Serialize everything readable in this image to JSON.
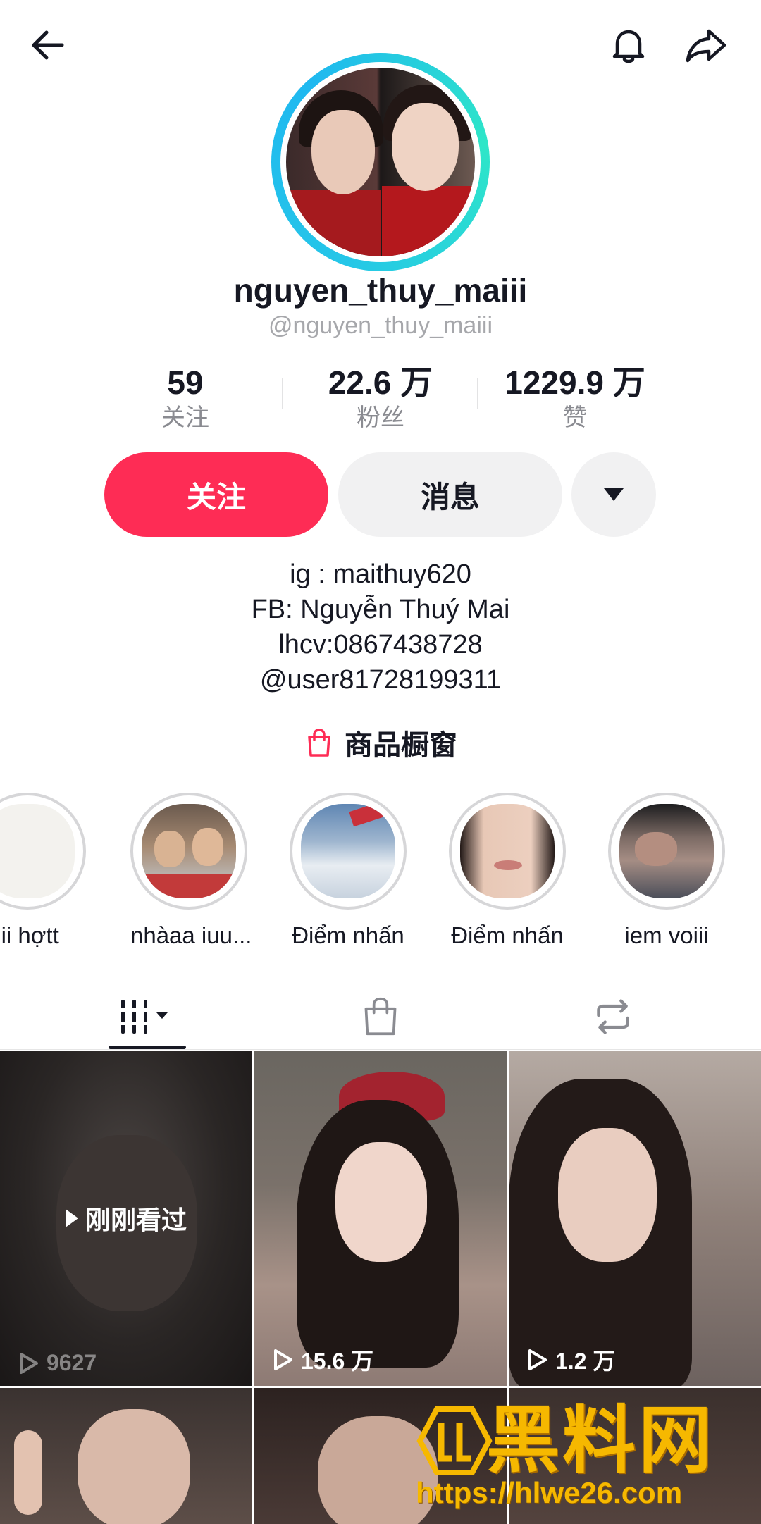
{
  "header": {
    "back_icon": "arrow-left-icon",
    "bell_icon": "bell-icon",
    "share_icon": "share-icon"
  },
  "profile": {
    "display_name": "nguyen_thuy_maiii",
    "handle": "@nguyen_thuy_maiii",
    "ring_color": "#25c6e8"
  },
  "stats": [
    {
      "value": "59",
      "label": "关注"
    },
    {
      "value": "22.6 万",
      "label": "粉丝"
    },
    {
      "value": "1229.9 万",
      "label": "赞"
    }
  ],
  "actions": {
    "follow_label": "关注",
    "message_label": "消息",
    "more_icon": "caret-down-icon",
    "follow_color": "#fe2c55"
  },
  "bio": {
    "lines": [
      "ig : maithuy620",
      "FB: Nguyễn Thuý Mai",
      "lhcv:0867438728",
      "@user81728199311"
    ]
  },
  "shop": {
    "label": "商品橱窗",
    "icon": "shopping-bag-icon"
  },
  "highlights": [
    {
      "label": "iii hợtt"
    },
    {
      "label": "nhàaa iuu..."
    },
    {
      "label": "Điểm nhấn"
    },
    {
      "label": "Điểm nhấn"
    },
    {
      "label": "iem voiii"
    }
  ],
  "tabs": [
    {
      "icon": "videos-grid-icon"
    },
    {
      "icon": "shopping-bag-icon"
    },
    {
      "icon": "repost-icon"
    }
  ],
  "videos": [
    {
      "views": "9627",
      "overlay": "刚刚看过"
    },
    {
      "views": "15.6 万"
    },
    {
      "views": "1.2 万"
    }
  ],
  "watermark": {
    "title": "黑料网",
    "url": "https://hlwe26.com"
  }
}
